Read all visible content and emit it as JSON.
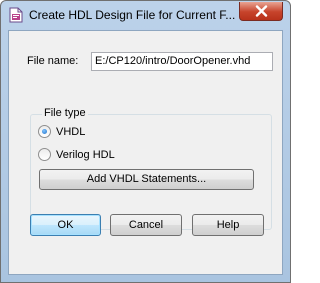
{
  "window": {
    "title": "Create HDL Design File for Current F...",
    "icon": "hdl-file-icon",
    "close_icon": "close-icon"
  },
  "form": {
    "file_name_label": "File name:",
    "file_name_value": "E:/CP120/intro/DoorOpener.vhd",
    "file_type_label": "File type",
    "options": [
      {
        "label": "VHDL",
        "selected": true
      },
      {
        "label": "Verilog HDL",
        "selected": false
      }
    ],
    "add_statements_label": "Add VHDL Statements..."
  },
  "buttons": {
    "ok": "OK",
    "cancel": "Cancel",
    "help": "Help"
  },
  "colors": {
    "title_bar": "#bcd2ea",
    "close_button": "#c7432b",
    "dialog_bg": "#f0f0f0",
    "default_button_border": "#3c7fb1"
  }
}
